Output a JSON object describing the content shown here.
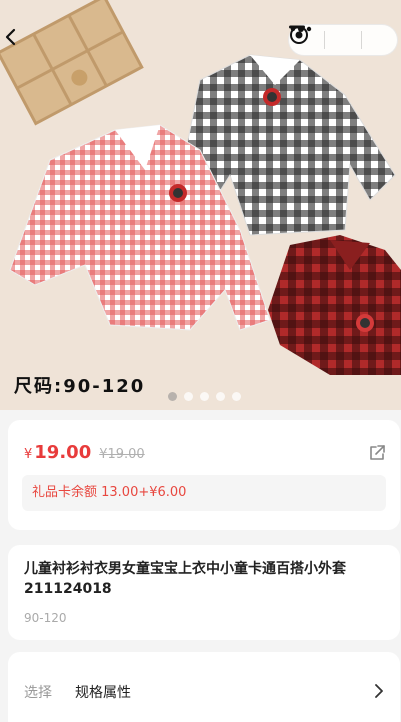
{
  "hero": {
    "caption": "尺码:90-120",
    "dots_count": 5,
    "active_dot": 0
  },
  "price": {
    "currency": "¥",
    "current": "19.00",
    "original": "¥19.00",
    "gift_card_text": "礼品卡余额 13.00+¥6.00"
  },
  "product": {
    "title": "儿童衬衫衬衣男女童宝宝上衣中小童卡通百搭小外套211124018",
    "subtitle": "90-120"
  },
  "spec": {
    "label": "选择",
    "value": "规格属性"
  },
  "colors": {
    "price_red": "#e83b3b",
    "gift_red": "#e8473f"
  }
}
